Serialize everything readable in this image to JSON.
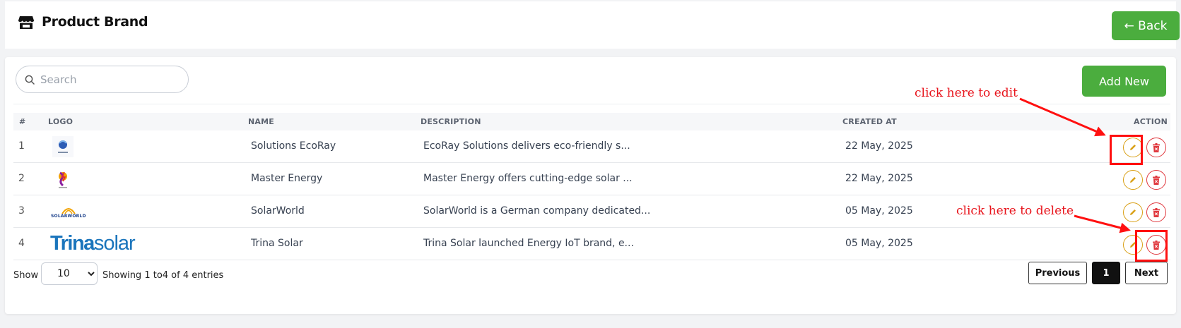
{
  "header": {
    "title": "Product Brand",
    "title_icon": "store-icon",
    "back_label": "← Back"
  },
  "toolbar": {
    "search_placeholder": "Search",
    "add_label": "Add New"
  },
  "table": {
    "columns": [
      "#",
      "LOGO",
      "NAME",
      "DESCRIPTION",
      "CREATED AT",
      "ACTION"
    ],
    "rows": [
      {
        "num": "1",
        "logo": "ecoray-logo",
        "name": "Solutions EcoRay",
        "description": "EcoRay Solutions delivers eco-friendly s...",
        "created": "22 May, 2025"
      },
      {
        "num": "2",
        "logo": "master-energy-logo",
        "name": "Master Energy",
        "description": "Master Energy offers cutting-edge solar ...",
        "created": "22 May, 2025"
      },
      {
        "num": "3",
        "logo": "solarworld-logo",
        "name": "SolarWorld",
        "description": "SolarWorld is a German company dedicated...",
        "created": "05 May, 2025"
      },
      {
        "num": "4",
        "logo": "trinasolar-logo",
        "name": "Trina Solar",
        "description": "Trina Solar launched Energy IoT brand, e...",
        "created": "05 May, 2025"
      }
    ],
    "logo_text": {
      "solarworld": "SOLARWORLD",
      "trina_a": "Trina",
      "trina_b": "solar"
    }
  },
  "footer": {
    "show_label": "Show",
    "page_size": "10",
    "page_size_options": [
      "10"
    ],
    "info": "Showing 1  to4  of 4 entries",
    "prev_label": "Previous",
    "current_page": "1",
    "next_label": "Next"
  },
  "annotations": {
    "edit": "click here to edit",
    "delete": "click here to delete"
  },
  "colors": {
    "accent_green": "#4bad3e",
    "edit_yellow": "#d9a016",
    "delete_red": "#e0383e",
    "annotation_red": "#e8141c"
  }
}
